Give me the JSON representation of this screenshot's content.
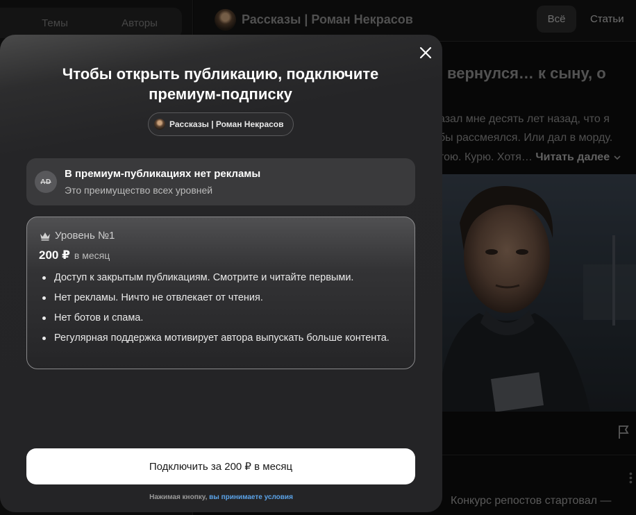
{
  "sidebar": {
    "tabs": [
      {
        "label": "Темы"
      },
      {
        "label": "Авторы"
      }
    ]
  },
  "header": {
    "channel_title": "Рассказы | Роман Некрасов",
    "filters": {
      "all": "Всё",
      "articles": "Статьи"
    }
  },
  "feed": {
    "article_title_line1": "вернулся… к сыну, о",
    "article_title_line2": "",
    "article_text_lines": [
      "азал мне десять лет назад, что я",
      "бы рассмеялся. Или дал в морду.",
      "тою. Курю. Хотя…"
    ],
    "read_more": "Читать далее",
    "next_post_text": "Конкурс репостов стартовал —"
  },
  "modal": {
    "title": "Чтобы открыть публикацию, подключите премиум-подписку",
    "author_chip": "Рассказы | Роман Некрасов",
    "ad_card": {
      "icon_text": "AD",
      "title": "В премиум-публикациях нет рекламы",
      "subtitle": "Это преимущество всех уровней"
    },
    "tier": {
      "name": "Уровень №1",
      "price": "200 ₽",
      "period": "в месяц",
      "benefits": [
        "Доступ к закрытым публикациям. Смотрите и читайте первыми.",
        "Нет рекламы. Ничто не отвлекает от чтения.",
        "Нет ботов и спама.",
        "Регулярная поддержка мотивирует автора выпускать больше контента."
      ]
    },
    "subscribe_button": "Подключить за 200 ₽ в месяц",
    "terms_prefix": "Нажимая кнопку,",
    "terms_link": "вы принимаете условия"
  },
  "colors": {
    "modal_bg": "#252527",
    "card_bg": "#3a3a3c",
    "link": "#5ba3e8",
    "button_bg": "#ffffff"
  },
  "icons": [
    "close-icon",
    "crown-icon",
    "no-ads-icon",
    "flag-icon",
    "more-dots-icon",
    "chevron-down-icon"
  ]
}
